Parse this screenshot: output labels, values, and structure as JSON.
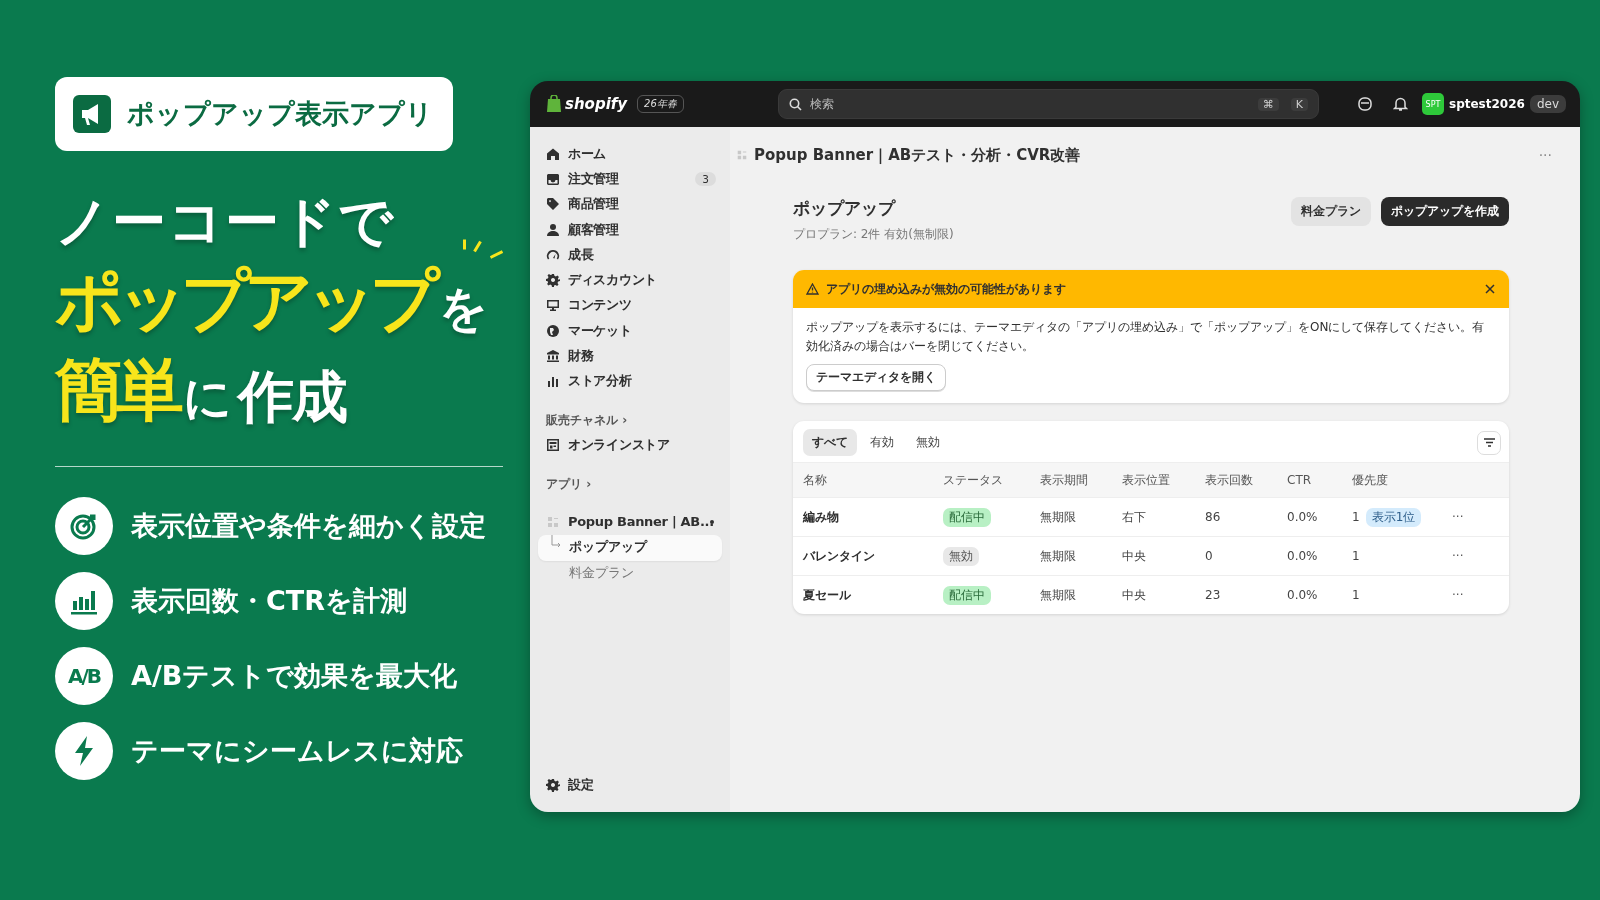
{
  "promo": {
    "badge": {
      "label": "ポップアップ表示アプリ"
    },
    "headline": [
      {
        "segments": [
          {
            "text": "ノーコードで",
            "kind": "plain"
          }
        ]
      },
      {
        "segments": [
          {
            "text": "ポップアップ",
            "kind": "highlight"
          },
          {
            "text": "を",
            "kind": "small"
          }
        ]
      },
      {
        "segments": [
          {
            "text": "簡単",
            "kind": "highlight"
          },
          {
            "text": "に",
            "kind": "small"
          },
          {
            "text": "作成",
            "kind": "plain"
          }
        ]
      }
    ],
    "features": [
      {
        "kind": "target",
        "text": "表示位置や条件を細かく設定"
      },
      {
        "kind": "chart",
        "text": "表示回数・CTRを計測"
      },
      {
        "kind": "ab",
        "icon_text": "A/B",
        "text": "A/Bテストで効果を最大化"
      },
      {
        "kind": "bolt",
        "text": "テーマにシームレスに対応"
      }
    ]
  },
  "topbar": {
    "brand": "shopify",
    "edition": "26年春",
    "search": {
      "placeholder": "検索"
    },
    "shortcut": [
      "⌘",
      "K"
    ],
    "avatar": "SPT",
    "store": "sptest2026",
    "store_tag": "dev"
  },
  "sidebar": {
    "items": [
      {
        "label": "ホーム"
      },
      {
        "label": "注文管理",
        "badge": "3"
      },
      {
        "label": "商品管理"
      },
      {
        "label": "顧客管理"
      },
      {
        "label": "成長"
      },
      {
        "label": "ディスカウント"
      },
      {
        "label": "コンテンツ"
      },
      {
        "label": "マーケット"
      },
      {
        "label": "財務"
      },
      {
        "label": "ストア分析"
      }
    ],
    "sections": [
      {
        "title": "販売チャネル ›",
        "items": [
          {
            "label": "オンラインストア"
          }
        ]
      },
      {
        "title": "アプリ ›",
        "items": [
          {
            "label": "Popup Banner | AB...",
            "pinned": true,
            "children": [
              {
                "label": "ポップアップ",
                "selected": true
              },
              {
                "label": "料金プラン",
                "selected": false
              }
            ]
          }
        ]
      }
    ],
    "settings": {
      "label": "設定"
    }
  },
  "main": {
    "breadcrumb": "Popup Banner｜ABテスト・分析・CVR改善",
    "more": "···",
    "title": "ポップアップ",
    "subtitle": "プロプラン: 2件 有効(無制限)",
    "actions": [
      {
        "label": "料金プラン",
        "kind": "secondary"
      },
      {
        "label": "ポップアップを作成",
        "kind": "primary"
      }
    ],
    "banner": {
      "title": "アプリの埋め込みが無効の可能性があります",
      "body": "ポップアップを表示するには、テーマエディタの「アプリの埋め込み」で「ポップアップ」をONにして保存してください。有効化済みの場合はバーを閉じてください。",
      "button": "テーマエディタを開く"
    },
    "tabs": [
      {
        "label": "すべて",
        "selected": true
      },
      {
        "label": "有効",
        "selected": false
      },
      {
        "label": "無効",
        "selected": false
      }
    ],
    "table": {
      "columns": [
        "名称",
        "ステータス",
        "表示期間",
        "表示位置",
        "表示回数",
        "CTR",
        "優先度"
      ],
      "rows": [
        {
          "name": "編み物",
          "status": {
            "label": "配信中",
            "kind": "active"
          },
          "period": "無期限",
          "position": "右下",
          "views": "86",
          "ctr": "0.0%",
          "priority": "1",
          "priority_tag": "表示1位",
          "menu": "···"
        },
        {
          "name": "バレンタイン",
          "status": {
            "label": "無効",
            "kind": "inactive"
          },
          "period": "無期限",
          "position": "中央",
          "views": "0",
          "ctr": "0.0%",
          "priority": "1",
          "menu": "···"
        },
        {
          "name": "夏セール",
          "status": {
            "label": "配信中",
            "kind": "active"
          },
          "period": "無期限",
          "position": "中央",
          "views": "23",
          "ctr": "0.0%",
          "priority": "1",
          "menu": "···"
        }
      ]
    }
  }
}
